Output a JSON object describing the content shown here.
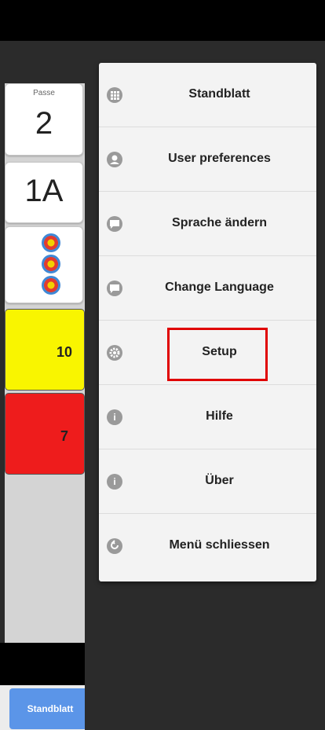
{
  "score_panel": {
    "passe_label": "Passe",
    "passe_number": "2",
    "target_id": "1A",
    "scores": [
      {
        "value": "10",
        "color": "#f9f500"
      },
      {
        "value": "7",
        "color": "#ee1c1c"
      }
    ],
    "bottom_button_label": "Standblatt"
  },
  "menu": {
    "items": [
      {
        "label": "Standblatt",
        "icon": "grid-icon"
      },
      {
        "label": "User preferences",
        "icon": "user-icon"
      },
      {
        "label": "Sprache ändern",
        "icon": "chat-bubble-icon"
      },
      {
        "label": "Change Language",
        "icon": "chat-bubble-icon"
      },
      {
        "label": "Setup",
        "icon": "gear-icon"
      },
      {
        "label": "Hilfe",
        "icon": "info-icon"
      },
      {
        "label": "Über",
        "icon": "info-icon"
      },
      {
        "label": "Menü schliessen",
        "icon": "back-arrow-icon"
      }
    ]
  },
  "highlight_target": "Setup"
}
